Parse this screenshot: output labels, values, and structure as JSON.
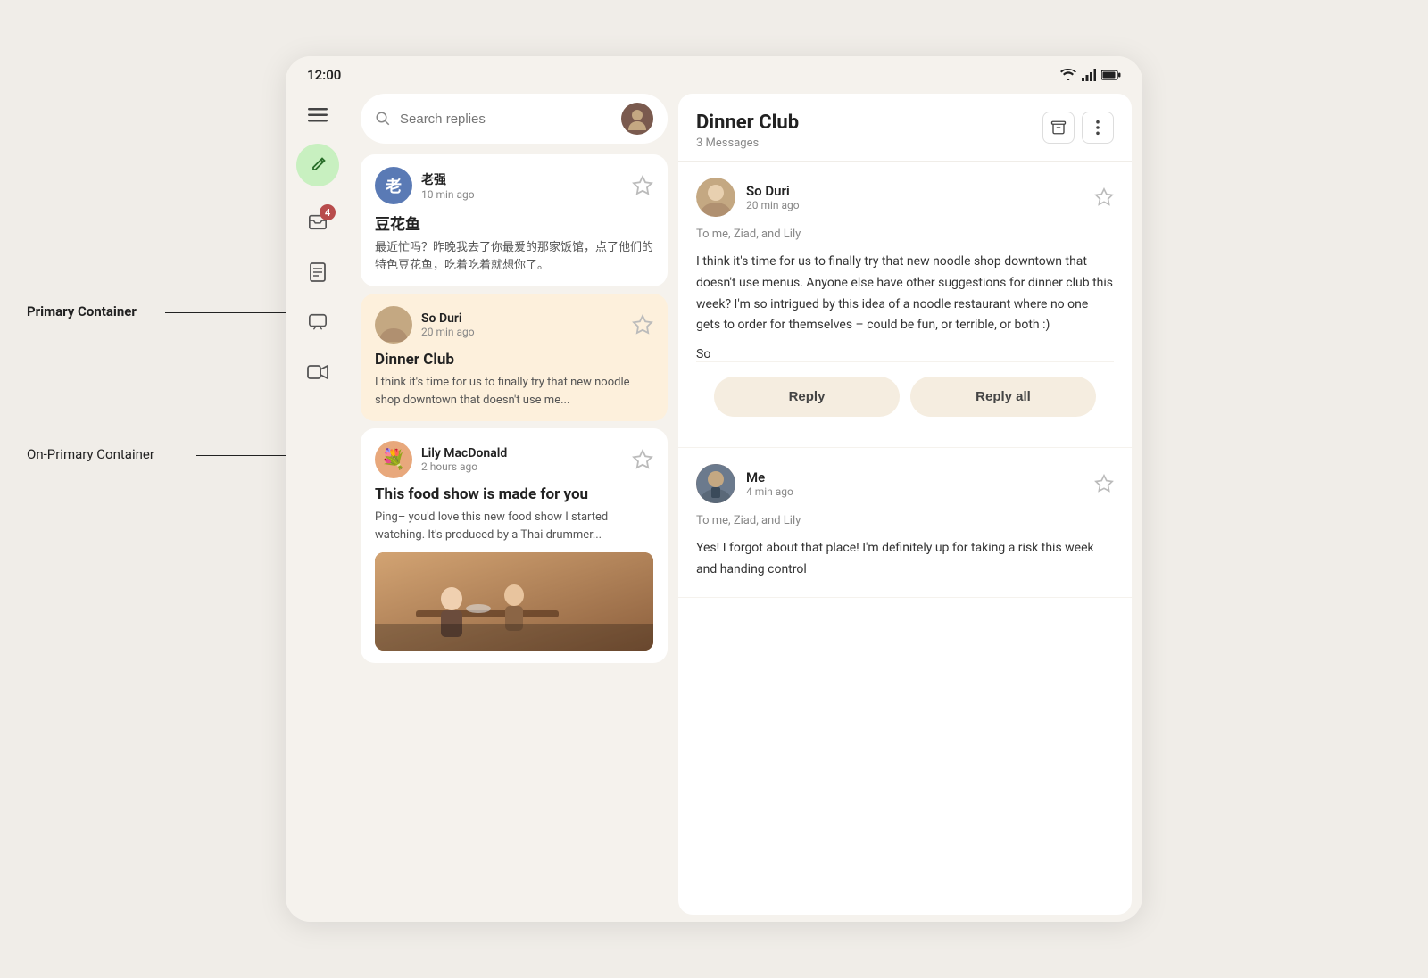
{
  "status_bar": {
    "time": "12:00",
    "icons": [
      "wifi",
      "signal",
      "battery"
    ]
  },
  "sidebar": {
    "icons": [
      {
        "name": "menu",
        "symbol": "☰",
        "badge": null
      },
      {
        "name": "compose",
        "symbol": "✏",
        "badge": null
      },
      {
        "name": "inbox",
        "symbol": "📥",
        "badge": "4"
      },
      {
        "name": "document",
        "symbol": "☰",
        "badge": null
      },
      {
        "name": "chat",
        "symbol": "□",
        "badge": null
      },
      {
        "name": "video",
        "symbol": "▷",
        "badge": null
      }
    ]
  },
  "search": {
    "placeholder": "Search replies"
  },
  "emails": [
    {
      "id": 1,
      "sender": "老强",
      "time": "10 min ago",
      "subject": "豆花鱼",
      "preview": "最近忙吗？昨晚我去了你最爱的那家饭馆，点了他们的特色豆花鱼，吃着吃着就想你了。",
      "selected": false,
      "avatar_color": "#5a7ab5"
    },
    {
      "id": 2,
      "sender": "So Duri",
      "time": "20 min ago",
      "subject": "Dinner Club",
      "preview": "I think it's time for us to finally try that new noodle shop downtown that doesn't use me...",
      "selected": true,
      "avatar_color": "#c4a882"
    },
    {
      "id": 3,
      "sender": "Lily MacDonald",
      "time": "2 hours ago",
      "subject": "This food show is made for you",
      "preview": "Ping– you'd love this new food show I started watching. It's produced by a Thai drummer...",
      "selected": false,
      "avatar_color": "#e8a87c",
      "has_image": true
    }
  ],
  "detail": {
    "title": "Dinner Club",
    "message_count": "3 Messages",
    "messages": [
      {
        "id": 1,
        "sender": "So Duri",
        "time": "20 min ago",
        "to": "To me, Ziad, and Lily",
        "body": "I think it's time for us to finally try that new noodle shop downtown that doesn't use menus. Anyone else have other suggestions for dinner club this week? I'm so intrigued by this idea of a noodle restaurant where no one gets to order for themselves – could be fun, or terrible, or both :)",
        "signature": "So",
        "avatar_color": "#c4a882"
      },
      {
        "id": 2,
        "sender": "Me",
        "time": "4 min ago",
        "to": "To me, Ziad, and Lily",
        "body": "Yes! I forgot about that place! I'm definitely up for taking a risk this week and handing control",
        "avatar_color": "#6b7a8d"
      }
    ],
    "reply_label": "Reply",
    "reply_all_label": "Reply all"
  },
  "annotations": {
    "primary_container": "Primary Container",
    "on_primary_container": "On-Primary Container"
  }
}
